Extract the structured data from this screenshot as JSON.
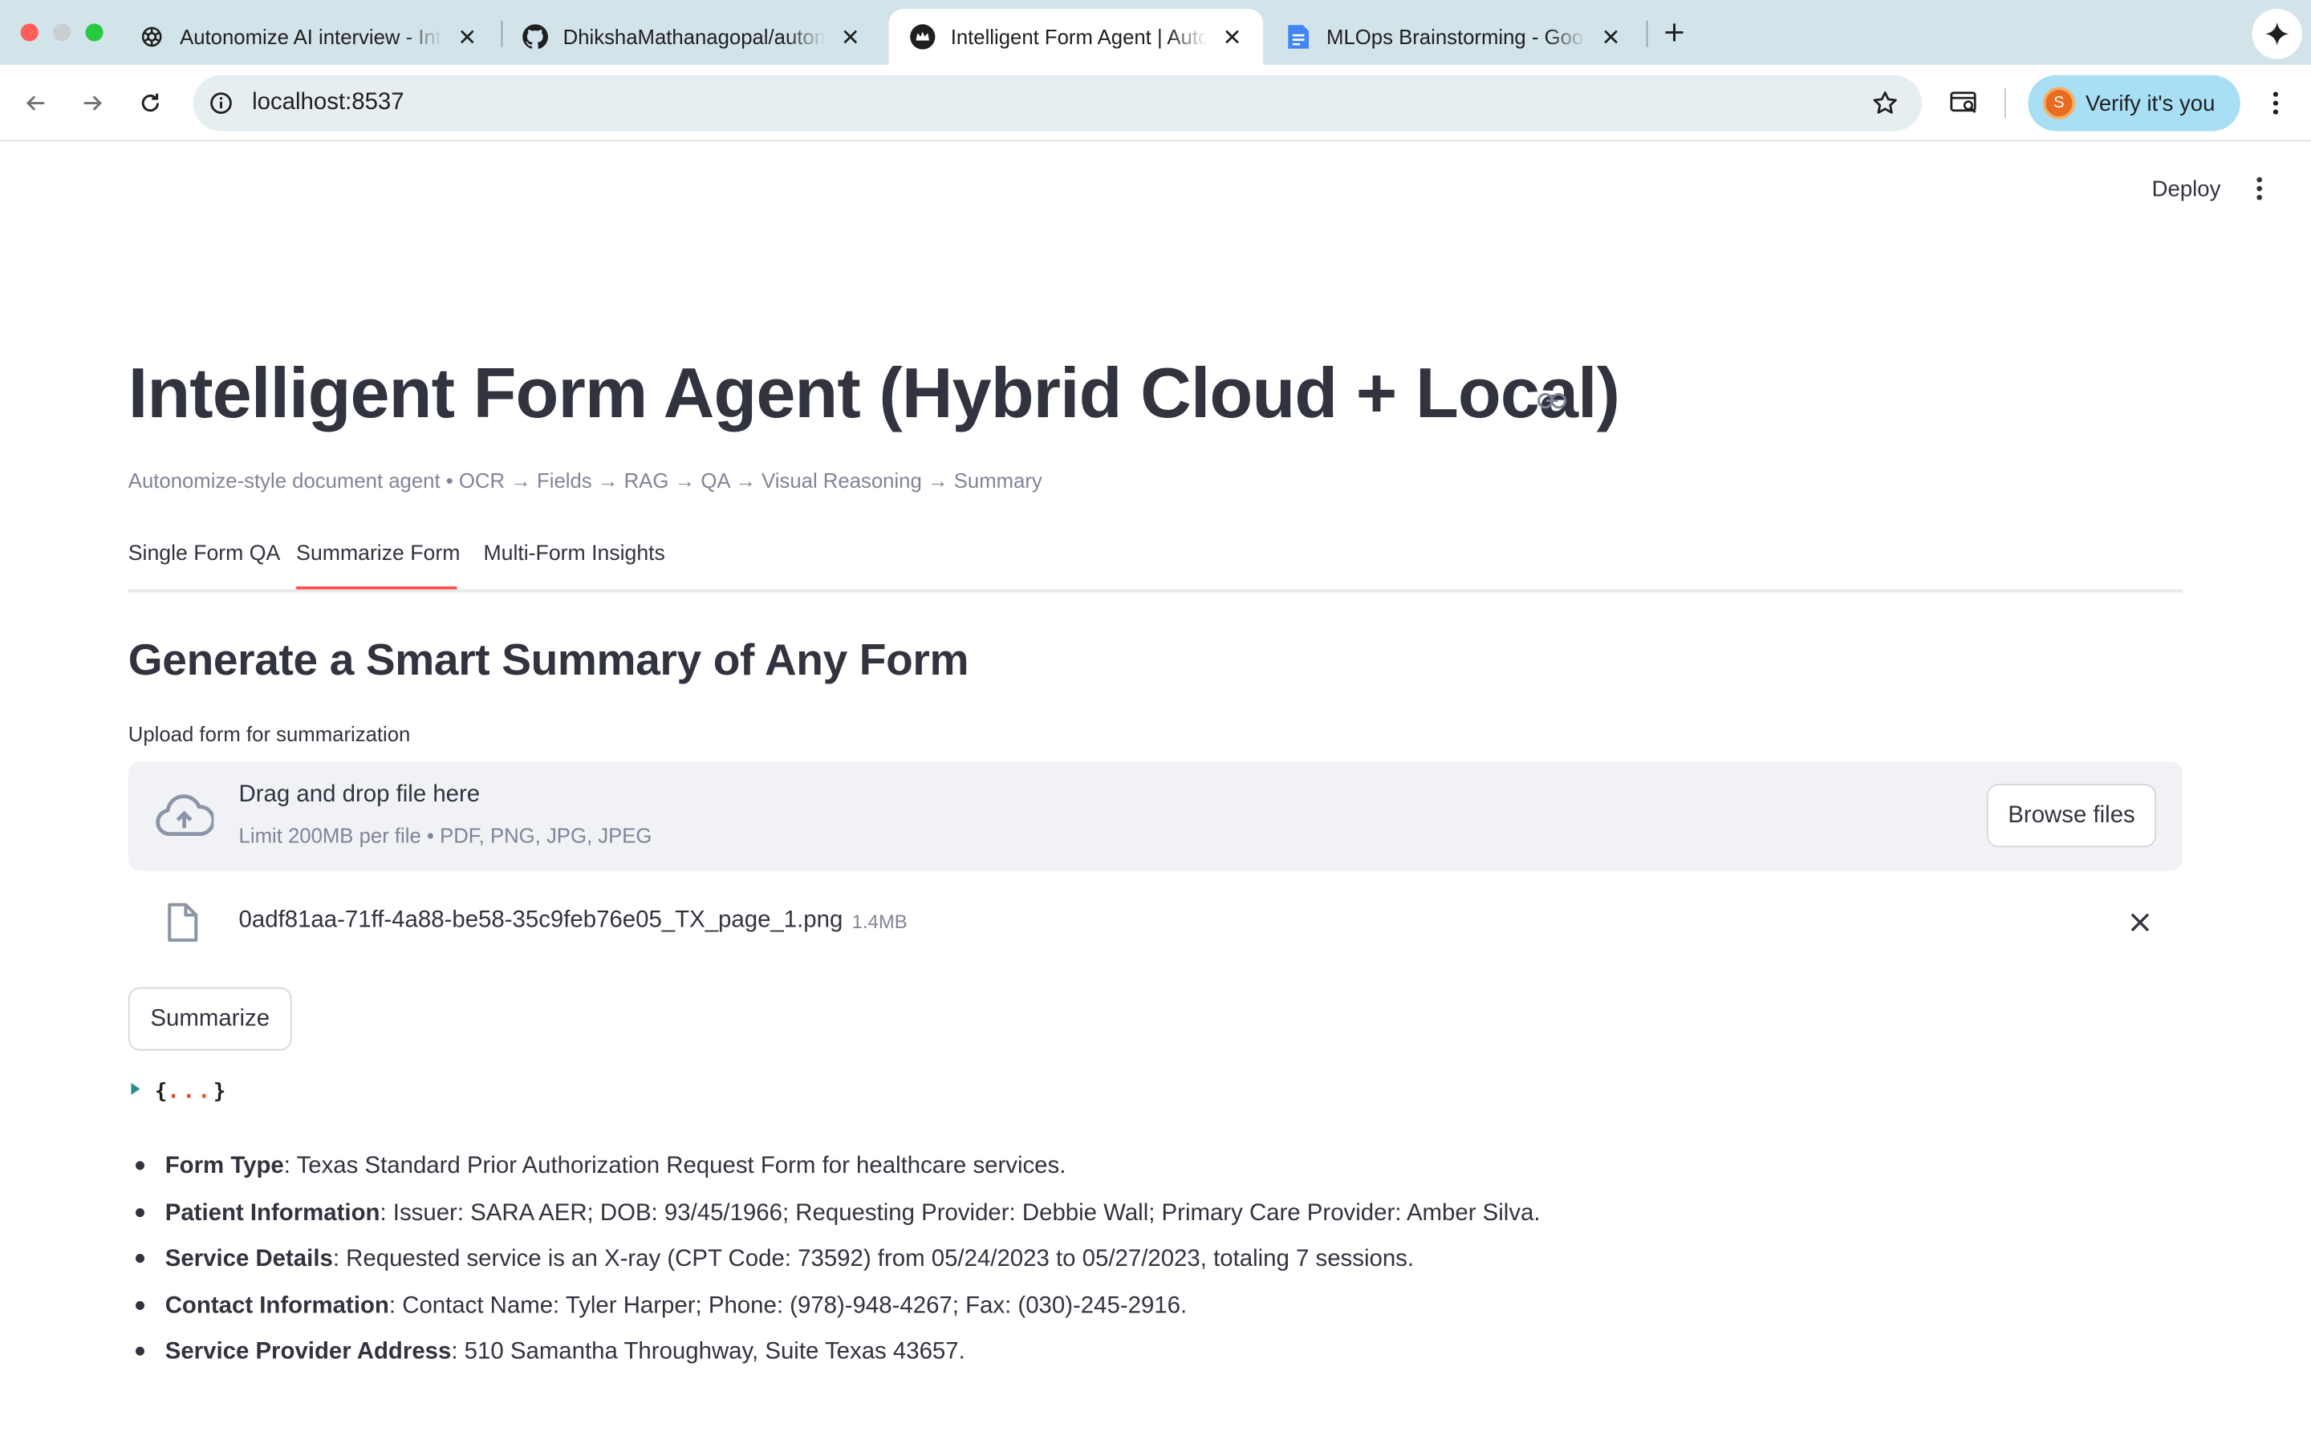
{
  "browser": {
    "tabs": [
      {
        "title": "Autonomize AI interview - Interview prep",
        "favicon": "openai-icon",
        "active": false
      },
      {
        "title": "DhikshaMathanagopal/autonomize-form-agent",
        "favicon": "github-icon",
        "active": false
      },
      {
        "title": "Intelligent Form Agent | Autonomize",
        "favicon": "streamlit-crown-icon",
        "active": true
      },
      {
        "title": "MLOps Brainstorming - Google Docs",
        "favicon": "google-docs-icon",
        "active": false
      }
    ],
    "url": "localhost:8537",
    "profile_button_label": "Verify it's you",
    "profile_initial": "S"
  },
  "app": {
    "deploy_label": "Deploy",
    "title": "Intelligent Form Agent (Hybrid Cloud + Local)",
    "caption": "Autonomize-style document agent • OCR → Fields → RAG → QA → Visual Reasoning → Summary",
    "tabs": [
      "Single Form QA",
      "Summarize Form",
      "Multi-Form Insights"
    ],
    "selected_tab": "Summarize Form",
    "section_heading": "Generate a Smart Summary of Any Form",
    "uploader": {
      "label": "Upload form for summarization",
      "drop_text": "Drag and drop file here",
      "limit_text": "Limit 200MB per file • PDF, PNG, JPG, JPEG",
      "browse_label": "Browse files"
    },
    "uploaded_file": {
      "name": "0adf81aa-71ff-4a88-be58-35c9feb76e05_TX_page_1.png",
      "size": "1.4MB"
    },
    "summarize_label": "Summarize",
    "json_preview": {
      "open": "{",
      "dots": "...",
      "close": "}"
    },
    "summary": [
      {
        "label": "Form Type",
        "text": ": Texas Standard Prior Authorization Request Form for healthcare services."
      },
      {
        "label": "Patient Information",
        "text": ": Issuer: SARA AER; DOB: 93/45/1966; Requesting Provider: Debbie Wall; Primary Care Provider: Amber Silva."
      },
      {
        "label": "Service Details",
        "text": ": Requested service is an X-ray (CPT Code: 73592) from 05/24/2023 to 05/27/2023, totaling 7 sessions."
      },
      {
        "label": "Contact Information",
        "text": ": Contact Name: Tyler Harper; Phone: (978)-948-4267; Fax: (030)-245-2916."
      },
      {
        "label": "Service Provider Address",
        "text": ": 510 Samantha Throughway, Suite Texas 43657."
      }
    ]
  },
  "colors": {
    "tabstrip": "#d3e3ea",
    "accent_underline": "#ff4b4b",
    "text_primary": "#31333f",
    "text_muted": "#808495",
    "dropzone_bg": "#f0f2f6",
    "verify_bg": "#a8dff5"
  }
}
